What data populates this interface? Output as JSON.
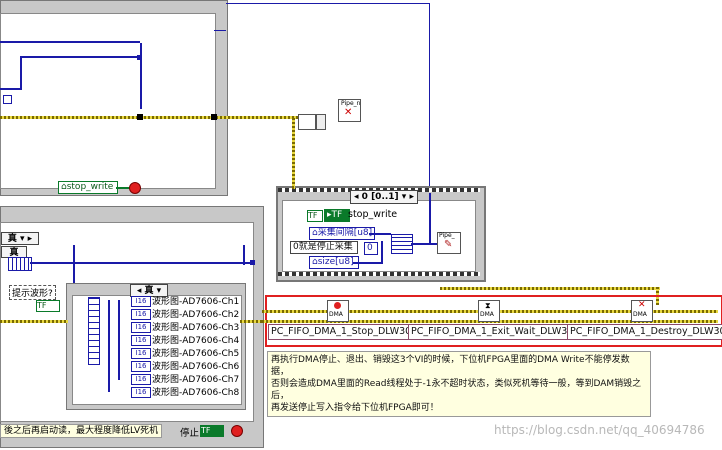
{
  "top_loop": {
    "stop_write_label": "stop_write",
    "pipe_node_label": "Pipe_n"
  },
  "sequence": {
    "selector": "0 [0..1]",
    "stop_write_label": "stop_write",
    "interval_label": "采集间隔[u8]",
    "stop_collect_label": "0就是停止采集",
    "size_label": "size[u8]",
    "const_zero": "0",
    "pipe_node_label": "Pipe_"
  },
  "left_case": {
    "case_true": "真",
    "inner_case_true": "真",
    "show_waveform": "提示波形?",
    "channels": [
      "波形图-AD7606-Ch1",
      "波形图-AD7606-Ch2",
      "波形图-AD7606-Ch3",
      "波形图-AD7606-Ch4",
      "波形图-AD7606-Ch5",
      "波形图-AD7606-Ch6",
      "波形图-AD7606-Ch7",
      "波形图-AD7606-Ch8"
    ],
    "i16_tag": "I16",
    "bottom_comment": "後之后再启动读，最大程度降低LV死机",
    "stop_label": "停止",
    "tf_label": "TF"
  },
  "dma": {
    "icon_text": "DMA",
    "stop_vi": "PC_FIFO_DMA_1_Stop_DLW30",
    "exit_wait_vi": "PC_FIFO_DMA_1_Exit_Wait_DLW30",
    "destroy_vi": "PC_FIFO_DMA_1_Destroy_DLW30"
  },
  "note_lines": [
    "再执行DMA停止、退出、销毁这3个VI的时候，下位机FPGA里面的DMA Write不能停发数据，",
    "否则会造成DMA里面的Read线程处于-1永不超时状态，类似死机等待一般，等到DAM销毁之后，",
    "再发送停止写入指令给下位机FPGA即可！"
  ],
  "watermark": "https://blog.csdn.net/qq_40694786",
  "colors": {
    "highlight_box": "#e02020",
    "wire_blue": "#1a1aa8",
    "wire_yellow": "#e8d840",
    "wire_green": "#0a7a2a",
    "frame_gray": "#c8c8c8"
  }
}
